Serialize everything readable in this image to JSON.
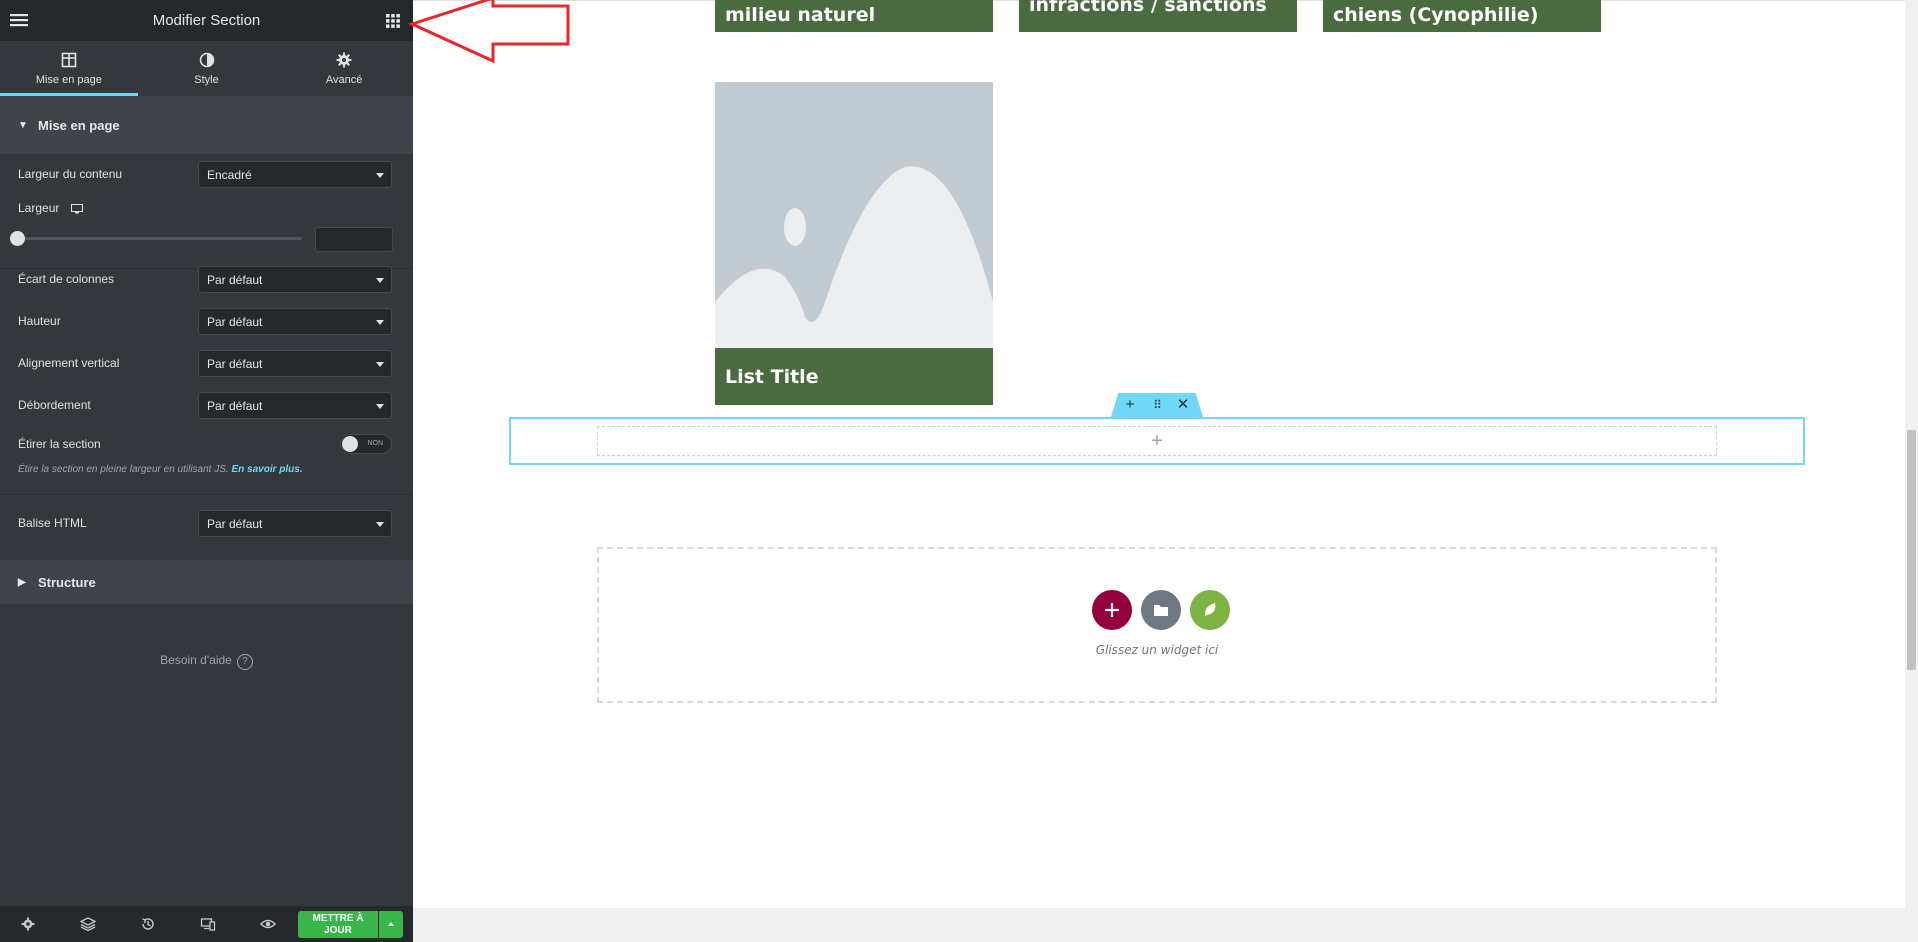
{
  "sidebar": {
    "header": {
      "title": "Modifier Section",
      "menu_icon": "hamburger-icon",
      "apps_icon": "grid-icon"
    },
    "tabs": [
      {
        "label": "Mise en page",
        "icon": "layout-icon",
        "active": true
      },
      {
        "label": "Style",
        "icon": "contrast-icon",
        "active": false
      },
      {
        "label": "Avancé",
        "icon": "gear-icon",
        "active": false
      }
    ],
    "section_layout": {
      "title": "Mise en page",
      "expanded": true
    },
    "controls": {
      "content_width": {
        "label": "Largeur du contenu",
        "value": "Encadré"
      },
      "width": {
        "label": "Largeur",
        "device_icon": "desktop-icon",
        "value": ""
      },
      "column_gap": {
        "label": "Écart de colonnes",
        "value": "Par défaut"
      },
      "height": {
        "label": "Hauteur",
        "value": "Par défaut"
      },
      "vertical_align": {
        "label": "Alignement vertical",
        "value": "Par défaut"
      },
      "overflow": {
        "label": "Débordement",
        "value": "Par défaut"
      },
      "stretch": {
        "label": "Étirer la section",
        "toggle": "NON",
        "description": "Étire la section en pleine largeur en utilisant JS.",
        "link": "En savoir plus."
      },
      "html_tag": {
        "label": "Balise HTML",
        "value": "Par défaut"
      }
    },
    "section_structure": {
      "title": "Structure",
      "expanded": false
    },
    "help": {
      "label": "Besoin d'aide"
    },
    "footer": {
      "icons": [
        "settings-icon",
        "layers-icon",
        "history-icon",
        "responsive-icon",
        "eye-icon"
      ],
      "update_label": "METTRE À JOUR",
      "update_color": "#39b54a"
    }
  },
  "canvas": {
    "cards_top": [
      "milieu naturel",
      "infractions / sanctions",
      "chiens (Cynophilie)"
    ],
    "list_title": "List Title",
    "card_color": "#4a6b3f",
    "section_handle_icons": [
      "plus-icon",
      "drag-icon",
      "close-icon"
    ],
    "dropzone": {
      "text": "Glissez un widget ici",
      "buttons": [
        {
          "name": "add",
          "color": "#93003c"
        },
        {
          "name": "template",
          "color": "#6d7882"
        },
        {
          "name": "envato",
          "color": "#7cb342"
        }
      ]
    }
  },
  "accent": "#71d7f7"
}
